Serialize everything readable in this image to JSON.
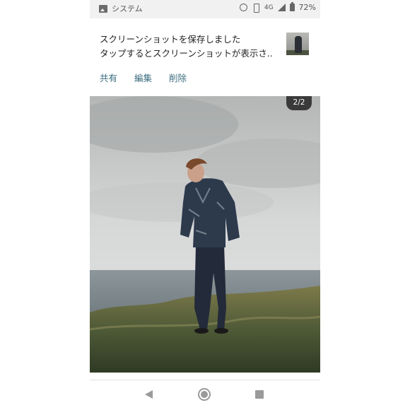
{
  "status_bar": {
    "app_icon": "image-icon",
    "app_label": "システム",
    "network": "4G",
    "battery_percent": "72%"
  },
  "notification": {
    "line1": "スクリーンショットを保存しました",
    "line2": "タップするとスクリーンショットが表示さ..",
    "actions": {
      "share": "共有",
      "edit": "編集",
      "delete": "削除"
    }
  },
  "viewer": {
    "counter": "2/2"
  },
  "nav_bar": {
    "back_icon": "back-triangle-icon",
    "home_icon": "home-circle-icon",
    "recents_icon": "recents-square-icon"
  }
}
